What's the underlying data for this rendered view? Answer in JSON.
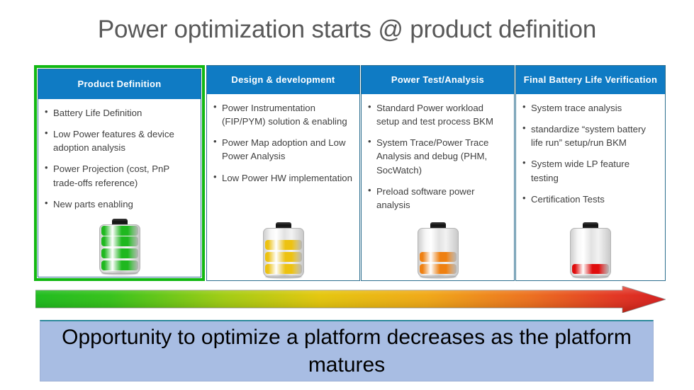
{
  "title": "Power optimization starts @ product definition",
  "colors": {
    "header_blue": "#0f7bc4",
    "highlight_green": "#12b812",
    "card_border": "#2d6e8e",
    "banner_fill": "#a8bde3",
    "banner_border": "#2e8b9b",
    "title_gray": "#595959",
    "arrow_start": "#17b317",
    "arrow_mid": "#e8c000",
    "arrow_end": "#e01b1b"
  },
  "columns": [
    {
      "header": "Product Definition",
      "highlighted": true,
      "bullets": [
        "Battery Life Definition",
        "Low Power features & device adoption analysis",
        "Power Projection (cost, PnP trade-offs reference)",
        "New parts enabling"
      ],
      "battery": {
        "icon": "battery-full-icon",
        "level_label": "4 of 4",
        "segments": 4,
        "filled": 4,
        "fill_color": "#1fb81f"
      }
    },
    {
      "header": "Design & development",
      "highlighted": false,
      "bullets": [
        "Power Instrumentation (FIP/PYM) solution & enabling",
        "Power Map adoption and Low Power Analysis",
        "Low Power HW implementation"
      ],
      "battery": {
        "icon": "battery-three-quarters-icon",
        "level_label": "3 of 4",
        "segments": 4,
        "filled": 3,
        "fill_color": "#edc211"
      }
    },
    {
      "header": "Power Test/Analysis",
      "highlighted": false,
      "bullets": [
        "Standard Power workload setup and test process BKM",
        "System Trace/Power Trace Analysis and debug (PHM, SocWatch)",
        "Preload software power analysis"
      ],
      "battery": {
        "icon": "battery-half-icon",
        "level_label": "2 of 4",
        "segments": 4,
        "filled": 2,
        "fill_color": "#ef8011"
      }
    },
    {
      "header": "Final Battery Life Verification",
      "highlighted": false,
      "bullets": [
        "System trace analysis",
        "standardize “system battery life run” setup/run BKM",
        "System wide LP feature testing",
        "Certification Tests"
      ],
      "battery": {
        "icon": "battery-low-icon",
        "level_label": "1 of 4",
        "segments": 4,
        "filled": 1,
        "fill_color": "#e00d0d"
      }
    }
  ],
  "arrow": {
    "icon": "right-arrow-gradient-icon",
    "direction": "right",
    "meaning": "optimization opportunity decreases left to right"
  },
  "banner": {
    "text": "Opportunity to optimize a platform decreases as the platform matures"
  }
}
